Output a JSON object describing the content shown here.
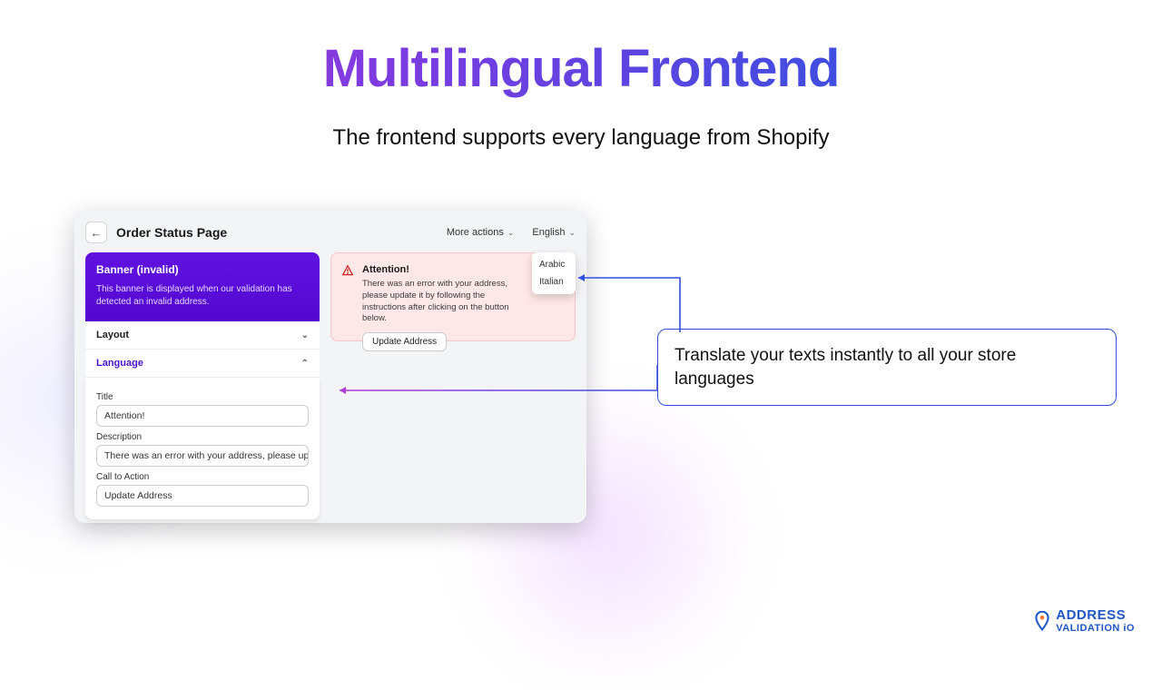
{
  "headline": "Multilingual Frontend",
  "subhead": "The frontend supports every language from Shopify",
  "panel": {
    "page_title": "Order Status Page",
    "more_actions": "More actions",
    "language_selector": "English",
    "language_options": [
      "Arabic",
      "Italian"
    ],
    "banner": {
      "title": "Banner (invalid)",
      "desc": "This banner is displayed when our validation has detected an invalid address."
    },
    "accordion_layout": "Layout",
    "accordion_language": "Language",
    "form": {
      "title_label": "Title",
      "title_value": "Attention!",
      "desc_label": "Description",
      "desc_value": "There was an error with your address, please update it b",
      "cta_label": "Call to Action",
      "cta_value": "Update Address"
    },
    "alert": {
      "title": "Attention!",
      "body": "There was an error with your address, please update it by following the instructions after clicking on the button below.",
      "button": "Update Address"
    }
  },
  "callout": "Translate your texts instantly to all your store languages",
  "logo": {
    "line1": "ADDRESS",
    "line2": "VALIDATION iO"
  }
}
